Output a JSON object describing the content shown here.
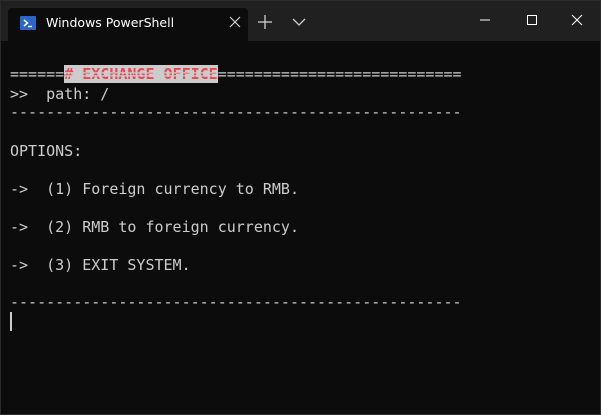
{
  "window": {
    "tab_title": "Windows PowerShell",
    "tab_icon": "powershell-icon",
    "buttons": {
      "tab_close": "close-icon",
      "new_tab": "plus-icon",
      "dropdown": "chevron-down-icon",
      "minimize": "minimize-icon",
      "maximize": "maximize-icon",
      "close": "close-icon"
    }
  },
  "terminal": {
    "colors": {
      "background": "#0c0c0c",
      "text": "#cccccc",
      "heading_fg": "#e74856",
      "heading_bg": "#cccccc"
    },
    "heading": "# EXCHANGE OFFICE",
    "double_rule": "==================================================",
    "path_line": ">>  path: /",
    "single_rule": "--------------------------------------------------",
    "options_label": "OPTIONS:",
    "options": [
      "->  (1) Foreign currency to RMB.",
      "->  (2) RMB to foreign currency.",
      "->  (3) EXIT SYSTEM."
    ],
    "bottom_rule": "--------------------------------------------------"
  }
}
